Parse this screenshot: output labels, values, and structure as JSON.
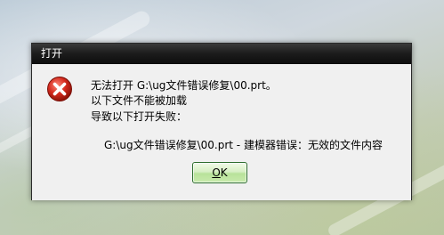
{
  "dialog": {
    "title": "打开",
    "icon": "error-icon",
    "message_line1": "无法打开 G:\\ug文件错误修复\\00.prt。",
    "message_line2": "以下文件不能被加载",
    "message_line3": "导致以下打开失败：",
    "detail": "G:\\ug文件错误修复\\00.prt - 建模器错误：无效的文件内容",
    "ok_label": "OK",
    "ok_mnemonic": "O",
    "ok_rest": "K"
  },
  "colors": {
    "title_bar": "#1c1c1c",
    "error_red": "#d42a1e",
    "ok_button": "#c8eaad"
  }
}
